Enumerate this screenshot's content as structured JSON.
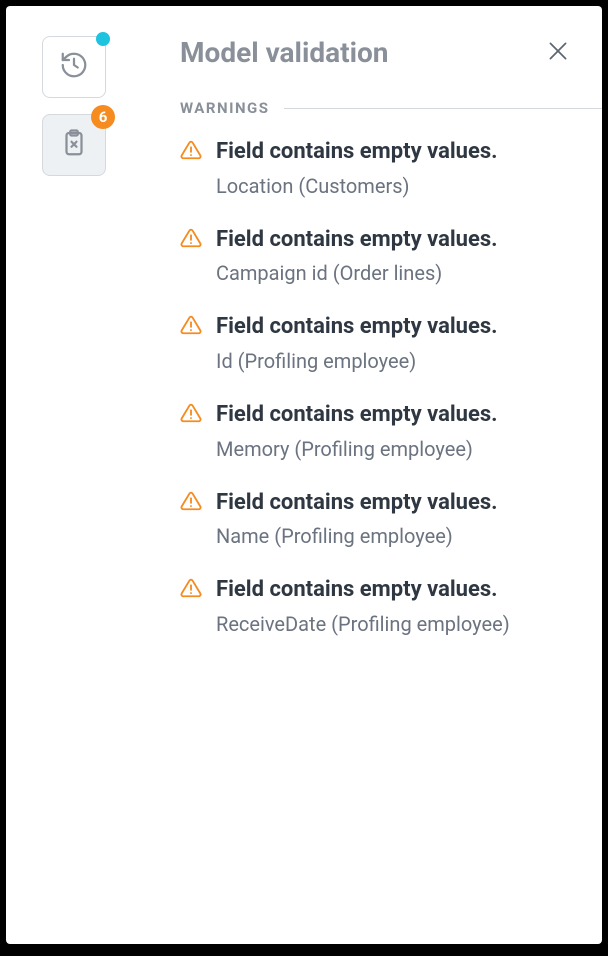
{
  "panel": {
    "title": "Model validation",
    "section_label": "WARNINGS"
  },
  "sidebar": {
    "validation_badge": "6"
  },
  "warnings": [
    {
      "title": "Field contains empty values.",
      "detail": "Location (Customers)"
    },
    {
      "title": "Field contains empty values.",
      "detail": "Campaign id (Order lines)"
    },
    {
      "title": "Field contains empty values.",
      "detail": "Id (Profiling employee)"
    },
    {
      "title": "Field contains empty values.",
      "detail": "Memory (Profiling employee)"
    },
    {
      "title": "Field contains empty values.",
      "detail": "Name (Profiling employee)"
    },
    {
      "title": "Field contains empty values.",
      "detail": "ReceiveDate (Profiling employee)"
    }
  ],
  "colors": {
    "warning": "#f68b1f",
    "notification_dot": "#1ec3e0"
  }
}
